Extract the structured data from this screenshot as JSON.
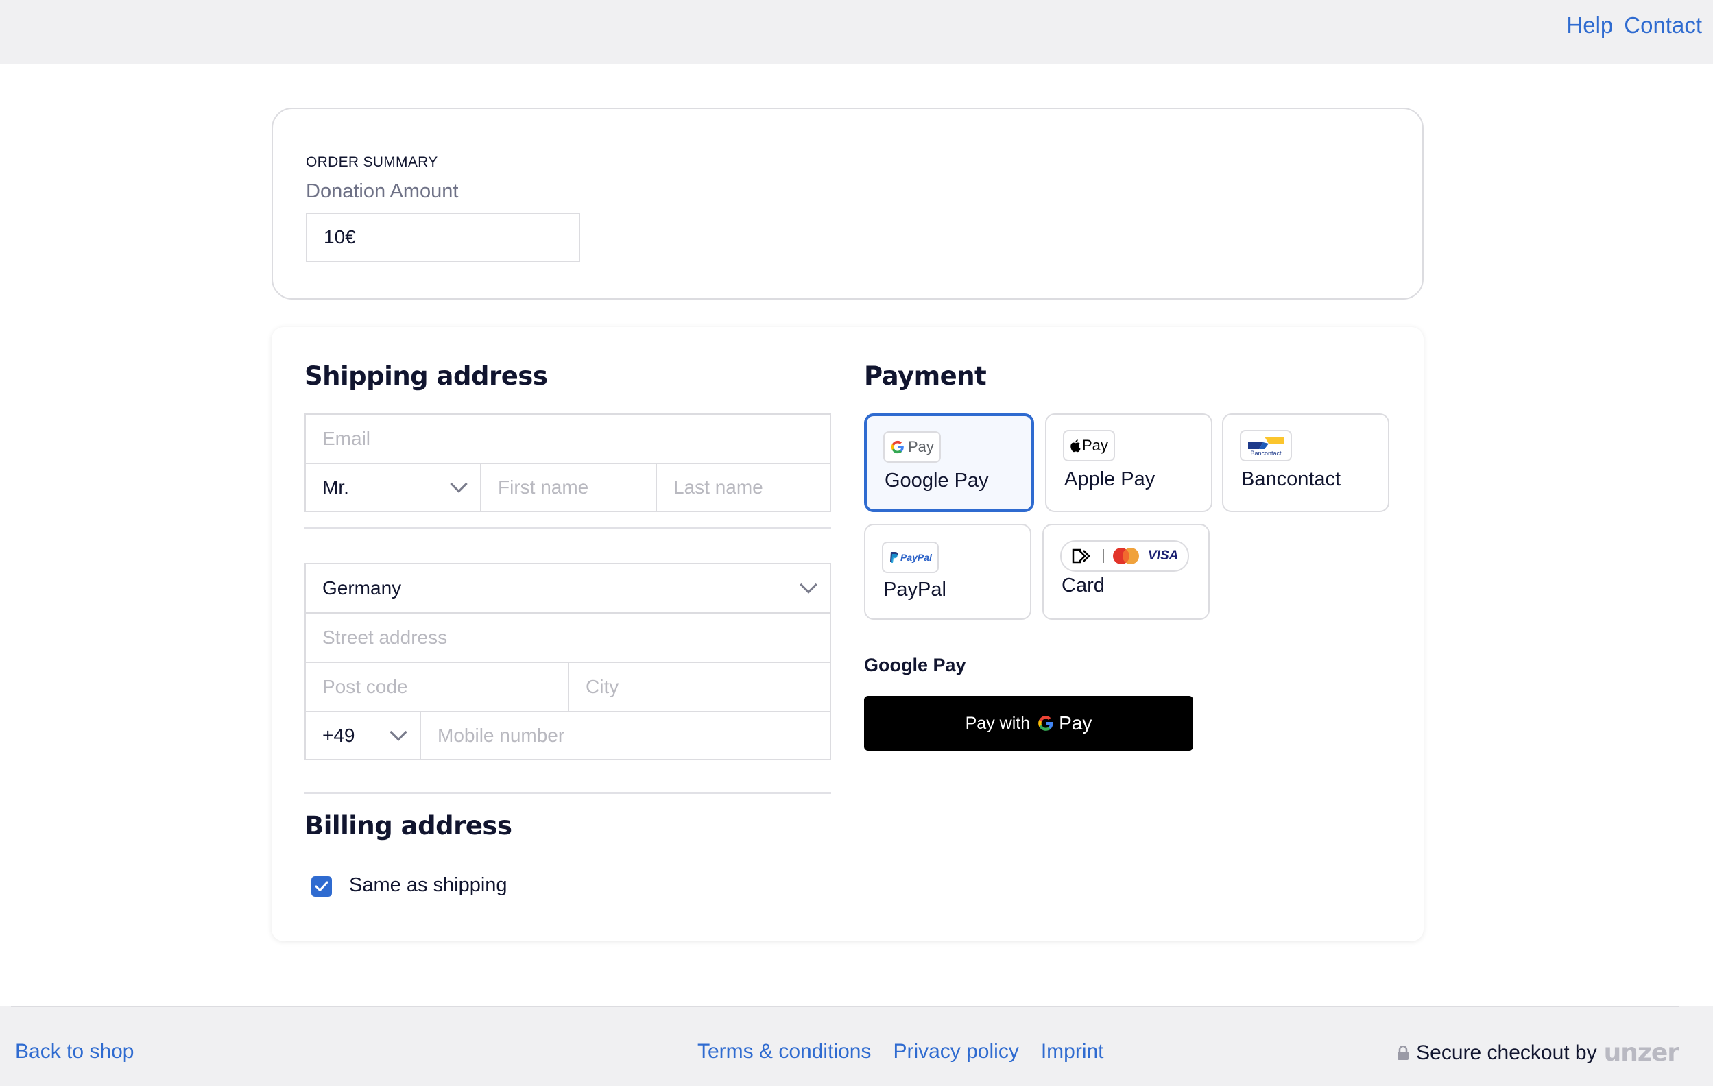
{
  "topbar": {
    "links": [
      {
        "label": "Help"
      },
      {
        "label": "Contact"
      }
    ]
  },
  "order_summary": {
    "eyebrow": "ORDER SUMMARY",
    "donation_label": "Donation Amount",
    "donation_value": "10€"
  },
  "shipping": {
    "title": "Shipping address",
    "email_placeholder": "Email",
    "salutation_value": "Mr.",
    "first_name_placeholder": "First name",
    "last_name_placeholder": "Last name",
    "country_value": "Germany",
    "street_placeholder": "Street address",
    "postcode_placeholder": "Post code",
    "city_placeholder": "City",
    "phone_prefix_value": "+49",
    "mobile_placeholder": "Mobile number"
  },
  "billing": {
    "title": "Billing address",
    "same_as_shipping_label": "Same as shipping",
    "same_as_shipping_checked": true
  },
  "payment": {
    "title": "Payment",
    "methods": [
      {
        "name": "Google Pay",
        "icon": "google-pay-logo",
        "selected": true
      },
      {
        "name": "Apple Pay",
        "icon": "apple-pay-logo",
        "selected": false
      },
      {
        "name": "Bancontact",
        "icon": "bancontact-logo",
        "selected": false
      },
      {
        "name": "PayPal",
        "icon": "paypal-logo",
        "selected": false
      },
      {
        "name": "Card",
        "icon": "card-brands-logo",
        "selected": false
      }
    ],
    "selected_title": "Google Pay",
    "pay_button_prefix": "Pay with",
    "pay_button_brand": "Pay",
    "logo_texts": {
      "gpay": "Pay",
      "applepay": "Pay",
      "bancontact": "Bancontact",
      "paypal": "PayPal",
      "visa": "VISA"
    }
  },
  "footer": {
    "back_label": "Back to shop",
    "links": [
      {
        "label": "Terms & conditions"
      },
      {
        "label": "Privacy policy"
      },
      {
        "label": "Imprint"
      }
    ],
    "secure_label": "Secure checkout by",
    "brand": "unzer"
  },
  "colors": {
    "accent": "#2f6bd0",
    "text": "#11152f",
    "muted": "#6e7186",
    "placeholder": "#b9b9c0",
    "border": "#dcdce0",
    "bar_bg": "#f0f0f2"
  }
}
